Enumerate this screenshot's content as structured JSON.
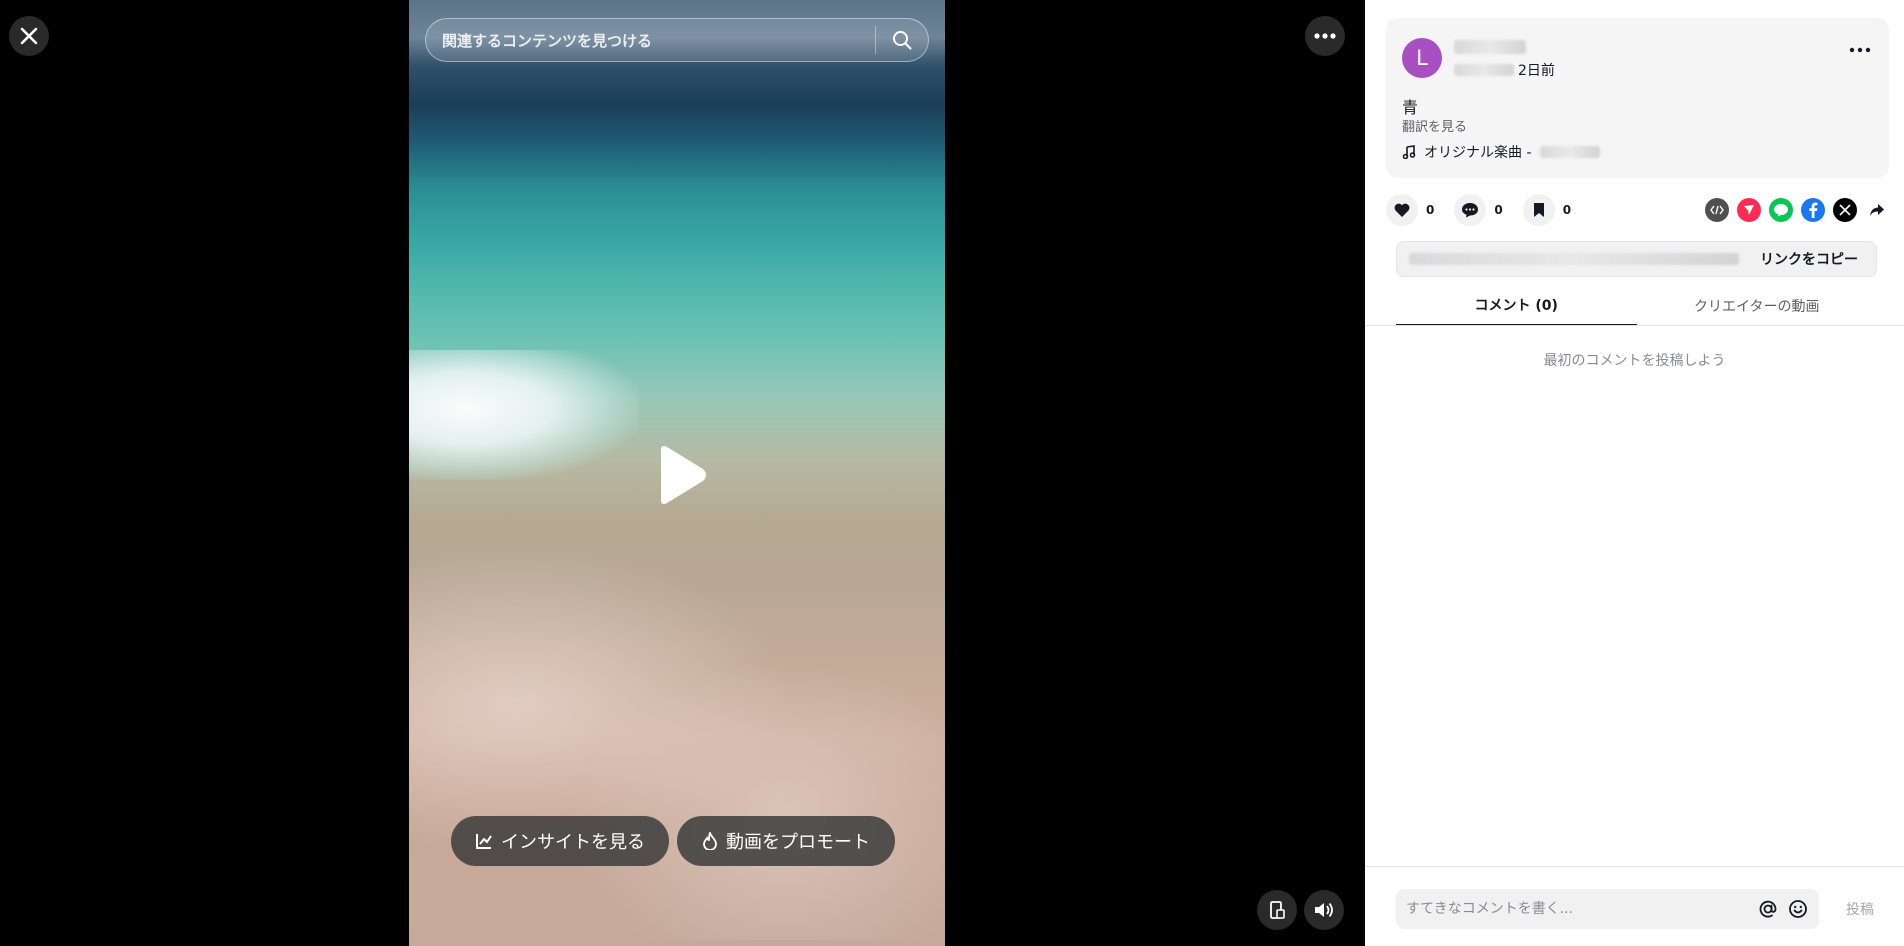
{
  "player": {
    "search_placeholder": "関連するコンテンツを見つける",
    "insights_label": "インサイトを見る",
    "promote_label": "動画をプロモート"
  },
  "post": {
    "avatar_letter": "L",
    "time_ago": "2日前",
    "caption": "青",
    "translate_label": "翻訳を見る",
    "music_label": "オリジナル楽曲 -",
    "likes": "0",
    "comments": "0",
    "saves": "0",
    "copy_link_label": "リンクをコピー"
  },
  "tabs": {
    "comments_label": "コメント (0)",
    "creator_videos_label": "クリエイターの動画"
  },
  "comments": {
    "empty_text": "最初のコメントを投稿しよう",
    "input_placeholder": "すてきなコメントを書く...",
    "post_label": "投稿"
  },
  "icons": {
    "close": "close-icon",
    "more": "more-icon",
    "search": "search-icon",
    "play": "play-icon",
    "chart": "chart-icon",
    "flame": "flame-icon",
    "phone_lock": "phone-icon",
    "volume": "volume-icon",
    "heart": "heart-icon",
    "comment": "comment-icon",
    "bookmark": "bookmark-icon",
    "embed": "embed-icon",
    "send": "send-icon",
    "line": "line-icon",
    "facebook": "facebook-icon",
    "x": "x-icon",
    "share": "share-arrow-icon",
    "music": "music-note-icon",
    "mention": "at-icon",
    "emoji": "emoji-icon"
  },
  "colors": {
    "avatar": "#a84fc2",
    "embed": "#505050",
    "send": "#fe2c55",
    "line": "#06c755",
    "facebook": "#1877f2",
    "x": "#000000"
  }
}
